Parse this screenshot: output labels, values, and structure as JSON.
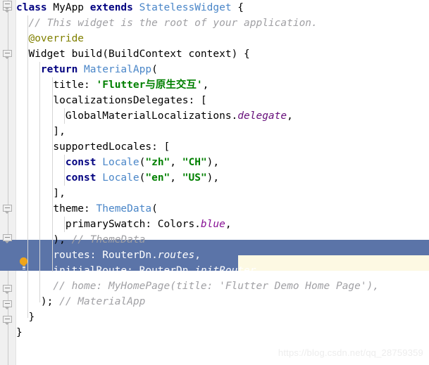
{
  "editor": {
    "language": "Dart",
    "font_size_px": 14.5,
    "line_height_px": 22,
    "background": "#ffffff",
    "gutter_background": "#f0f0f0",
    "selection_color": "#5b74a8",
    "selection_text_color": "#ffffff",
    "caret_row_color": "#fdf9e3",
    "indent_guide_color": "#d6d6d6",
    "fold_rail_color": "#c9c9c9"
  },
  "palette": {
    "keyword": "#000080",
    "class_name": "#4a86c8",
    "string": "#008000",
    "comment": "#a0a0a4",
    "annotation": "#808000",
    "field_italic": "#871094",
    "plain_text": "#000000"
  },
  "gutter": {
    "bulb_icon": "lightbulb-icon",
    "bulb_color": "#f0a519",
    "fold_markers": [
      {
        "name": "fold-marker-class",
        "line": 0
      },
      {
        "name": "fold-marker-build",
        "line": 3
      },
      {
        "name": "fold-marker-materialapp",
        "line": 4
      },
      {
        "name": "fold-marker-themedata",
        "line": 12
      },
      {
        "name": "fold-marker-themedata-end",
        "line": 14
      },
      {
        "name": "fold-marker-materialapp-end",
        "line": 18
      },
      {
        "name": "fold-marker-build-end",
        "line": 19
      },
      {
        "name": "fold-marker-class-end",
        "line": 20
      }
    ]
  },
  "code": {
    "lines": [
      {
        "n": 0,
        "indent_guides": [],
        "text": "class MyApp extends StatelessWidget {"
      },
      {
        "n": 1,
        "indent_guides": [
          0
        ],
        "text": "  // This widget is the root of your application."
      },
      {
        "n": 2,
        "indent_guides": [
          0
        ],
        "text": "  @override"
      },
      {
        "n": 3,
        "indent_guides": [
          0
        ],
        "text": "  Widget build(BuildContext context) {"
      },
      {
        "n": 4,
        "indent_guides": [
          0,
          1
        ],
        "text": "    return MaterialApp("
      },
      {
        "n": 5,
        "indent_guides": [
          0,
          1,
          2
        ],
        "text": "      title: 'Flutter与原生交互',"
      },
      {
        "n": 6,
        "indent_guides": [
          0,
          1,
          2
        ],
        "text": "      localizationsDelegates: ["
      },
      {
        "n": 7,
        "indent_guides": [
          0,
          1,
          2,
          3
        ],
        "text": "        GlobalMaterialLocalizations.delegate,"
      },
      {
        "n": 8,
        "indent_guides": [
          0,
          1,
          2
        ],
        "text": "      ],"
      },
      {
        "n": 9,
        "indent_guides": [
          0,
          1,
          2
        ],
        "text": "      supportedLocales: ["
      },
      {
        "n": 10,
        "indent_guides": [
          0,
          1,
          2,
          3
        ],
        "text": "        const Locale(\"zh\", \"CH\"),"
      },
      {
        "n": 11,
        "indent_guides": [
          0,
          1,
          2,
          3
        ],
        "text": "        const Locale(\"en\", \"US\"),"
      },
      {
        "n": 12,
        "indent_guides": [
          0,
          1,
          2
        ],
        "text": "      ],"
      },
      {
        "n": 13,
        "indent_guides": [
          0,
          1,
          2
        ],
        "text": "      theme: ThemeData("
      },
      {
        "n": 14,
        "indent_guides": [
          0,
          1,
          2,
          3
        ],
        "text": "        primarySwatch: Colors.blue,"
      },
      {
        "n": 15,
        "indent_guides": [
          0,
          1,
          2
        ],
        "text": "      ), // ThemeData"
      },
      {
        "n": 16,
        "indent_guides": [
          0,
          1,
          2
        ],
        "text": "      routes: RouterDn.routes,"
      },
      {
        "n": 17,
        "indent_guides": [
          0,
          1,
          2
        ],
        "text": "      initialRoute: RouterDn.initRouter,"
      },
      {
        "n": 18,
        "indent_guides": [
          0,
          1,
          2
        ],
        "text": "      // home: MyHomePage(title: 'Flutter Demo Home Page'),"
      },
      {
        "n": 19,
        "indent_guides": [
          0,
          1
        ],
        "text": "    ); // MaterialApp"
      },
      {
        "n": 20,
        "indent_guides": [
          0
        ],
        "text": "  }"
      },
      {
        "n": 21,
        "indent_guides": [],
        "text": "}"
      }
    ],
    "tokens": {
      "l0": {
        "kw1": "class",
        "sp1": " ",
        "name": "MyApp",
        "sp2": " ",
        "kw2": "extends",
        "sp3": " ",
        "cls": "StatelessWidget",
        "tail": " {"
      },
      "l1": {
        "comment": "// This widget is the root of your application."
      },
      "l2": {
        "annotation": "@override"
      },
      "l3": {
        "ret": "Widget",
        "mid": " build(",
        "param_type": "BuildContext",
        "tail": " context) {"
      },
      "l4": {
        "kw": "return",
        "sp": " ",
        "cls": "MaterialApp",
        "tail": "("
      },
      "l5": {
        "key": "title: ",
        "str": "'Flutter与原生交互'",
        "tail": ","
      },
      "l6": {
        "text": "localizationsDelegates: ["
      },
      "l7": {
        "recv": "GlobalMaterialLocalizations.",
        "field": "delegate",
        "tail": ","
      },
      "l8": {
        "text": "],"
      },
      "l9": {
        "text": "supportedLocales: ["
      },
      "l10": {
        "kw": "const",
        "sp": " ",
        "cls": "Locale",
        "p1": "(",
        "s1": "\"zh\"",
        "c1": ", ",
        "s2": "\"CH\"",
        "tail": "),"
      },
      "l11": {
        "kw": "const",
        "sp": " ",
        "cls": "Locale",
        "p1": "(",
        "s1": "\"en\"",
        "c1": ", ",
        "s2": "\"US\"",
        "tail": "),"
      },
      "l12": {
        "text": "],"
      },
      "l13": {
        "key": "theme: ",
        "cls": "ThemeData",
        "tail": "("
      },
      "l14": {
        "key": "primarySwatch: Colors.",
        "field": "blue",
        "tail": ","
      },
      "l15": {
        "code": "), ",
        "comment": "// ThemeData"
      },
      "l16": {
        "key": "routes: RouterDn.",
        "field": "routes",
        "tail": ","
      },
      "l17": {
        "key": "initialRoute: RouterDn.",
        "field": "initRouter",
        "tail": ","
      },
      "l18": {
        "comment": "// home: MyHomePage(title: 'Flutter Demo Home Page'),"
      },
      "l19": {
        "code": "); ",
        "comment": "// MaterialApp"
      },
      "l20": {
        "text": "}"
      },
      "l21": {
        "text": "}"
      }
    }
  },
  "selection": {
    "full_line": 16,
    "partial_line": 17,
    "partial_start_col": 6,
    "partial_end_col": 41,
    "caret_line": 17
  },
  "watermark": {
    "text": "https://blog.csdn.net/qq_28759359"
  }
}
